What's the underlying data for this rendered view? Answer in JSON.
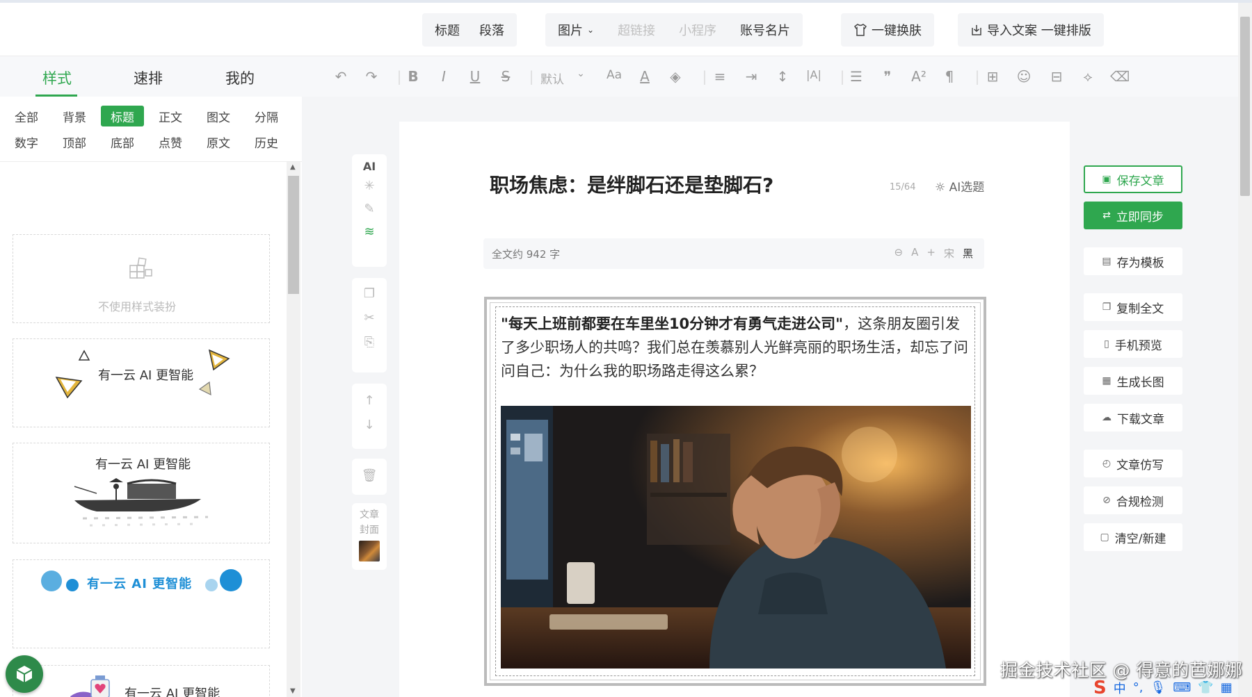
{
  "toolbar_top": {
    "group1": [
      "标题",
      "段落"
    ],
    "group2": [
      {
        "label": "图片",
        "has_caret": true,
        "disabled": false
      },
      {
        "label": "超链接",
        "disabled": true
      },
      {
        "label": "小程序",
        "disabled": true
      },
      {
        "label": "账号名片",
        "disabled": false
      }
    ],
    "skin_label": "一键换肤",
    "import_label": "导入文案 一键排版"
  },
  "left_tabs": [
    "样式",
    "速排",
    "我的"
  ],
  "categories": [
    "全部",
    "背景",
    "标题",
    "正文",
    "图文",
    "分隔",
    "数字",
    "顶部",
    "底部",
    "点赞",
    "原文",
    "历史"
  ],
  "active_category": "标题",
  "styles": {
    "none_label": "不使用样式装扮",
    "sample_text": "有一云 AI 更智能"
  },
  "format_toolbar": {
    "font_default": "默认"
  },
  "side_tools": {
    "ai_label": "AI",
    "cover_label": "文章封面"
  },
  "editor": {
    "title": "职场焦虑：是绊脚石还是垫脚石?",
    "title_count": "15/64",
    "ai_topic_label": "AI选题",
    "word_count": "全文约 942 字",
    "font_a": "A",
    "font_song": "宋",
    "font_hei": "黑",
    "quote_bold": "\"每天上班前都要在车里坐10分钟才有勇气走进公司\"",
    "quote_rest": "，这条朋友圈引发了多少职场人的共鸣？我们总在羡慕别人光鲜亮丽的职场生活，却忘了问问自己：为什么我的职场路走得这么累？"
  },
  "right_buttons": [
    "保存文章",
    "立即同步",
    "存为模板",
    "复制全文",
    "手机预览",
    "生成长图",
    "下载文章",
    "文章仿写",
    "合规检测",
    "清空/新建"
  ],
  "watermark": "掘金技术社区 @ 得意的芭娜娜",
  "ime": {
    "logo": "S",
    "lang": "中"
  },
  "colors": {
    "accent": "#2fa74f",
    "link_blue": "#1e8fd6"
  }
}
